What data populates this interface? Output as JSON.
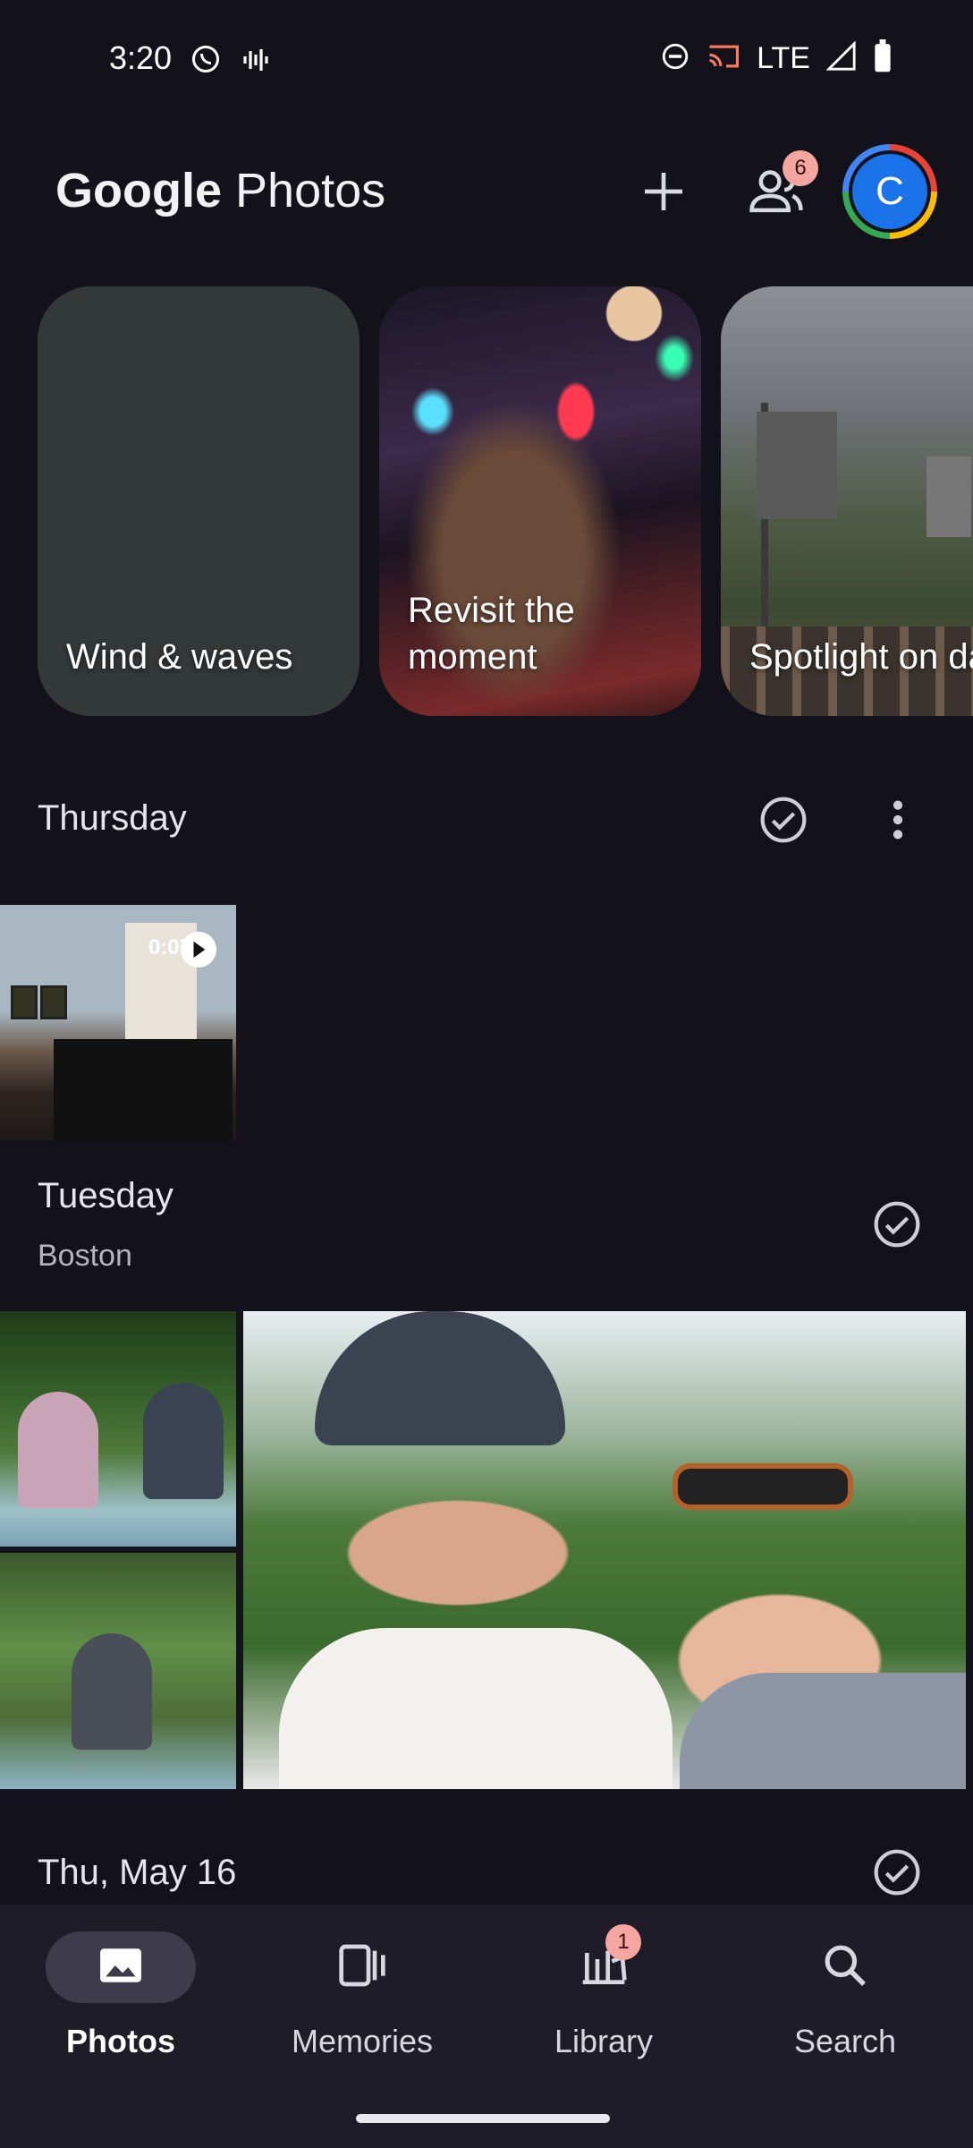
{
  "status": {
    "time": "3:20",
    "network": "LTE"
  },
  "app": {
    "logo_google": "Google",
    "logo_photos": "Photos"
  },
  "header": {
    "sharing_badge": "6",
    "avatar_initial": "C"
  },
  "memories": [
    {
      "label": "Wind & waves"
    },
    {
      "label": "Revisit the moment"
    },
    {
      "label": "Spotlight on day"
    }
  ],
  "sections": {
    "thursday": {
      "title": "Thursday"
    },
    "tuesday": {
      "title": "Tuesday",
      "location": "Boston"
    },
    "may16": {
      "title": "Thu, May 16"
    }
  },
  "video": {
    "duration": "0:07"
  },
  "nav": {
    "items": [
      {
        "label": "Photos"
      },
      {
        "label": "Memories"
      },
      {
        "label": "Library",
        "badge": "1"
      },
      {
        "label": "Search"
      }
    ]
  },
  "colors": {
    "background": "#13121a",
    "nav_bg": "#1e1d27",
    "badge": "#f5a6a0",
    "avatar": "#1a73e8"
  }
}
